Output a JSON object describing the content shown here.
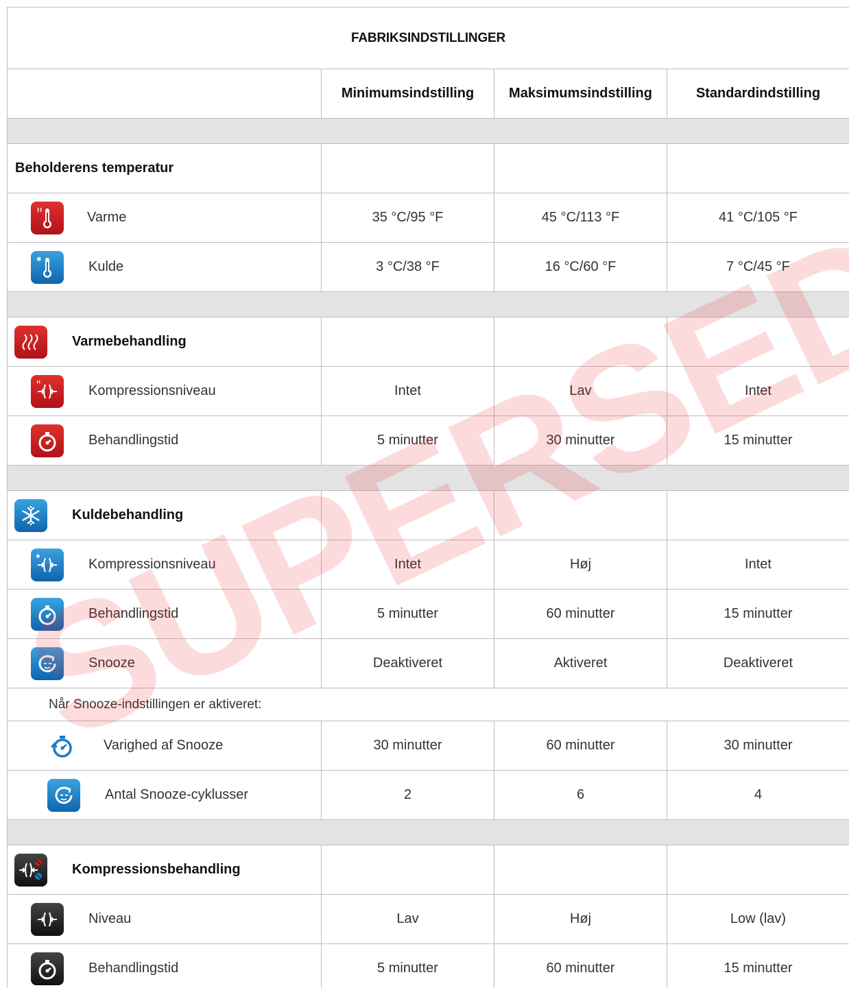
{
  "title": "FABRIKSINDSTILLINGER",
  "columns": [
    "",
    "Minimumsindstilling",
    "Maksimumsindstilling",
    "Standardindstilling"
  ],
  "sections": [
    {
      "label": "Beholderens temperatur",
      "icon": null,
      "rows": [
        {
          "icon": "heat-thermometer-icon",
          "label": "Varme",
          "min": "35 °C/95 °F",
          "max": "45 °C/113 °F",
          "std": "41 °C/105 °F"
        },
        {
          "icon": "cold-thermometer-icon",
          "label": "Kulde",
          "min": "3 °C/38 °F",
          "max": "16 °C/60 °F",
          "std": "7 °C/45 °F"
        }
      ]
    },
    {
      "label": "Varmebehandling",
      "icon": "heat-therapy-icon",
      "rows": [
        {
          "icon": "heat-compression-icon",
          "label": "Kompressionsniveau",
          "min": "Intet",
          "max": "Lav",
          "std": "Intet"
        },
        {
          "icon": "heat-timer-icon",
          "label": "Behandlingstid",
          "min": "5 minutter",
          "max": "30 minutter",
          "std": "15 minutter"
        }
      ]
    },
    {
      "label": "Kuldebehandling",
      "icon": "cold-therapy-icon",
      "rows": [
        {
          "icon": "cold-compression-icon",
          "label": "Kompressionsniveau",
          "min": "Intet",
          "max": "Høj",
          "std": "Intet"
        },
        {
          "icon": "cold-timer-icon",
          "label": "Behandlingstid",
          "min": "5 minutter",
          "max": "60 minutter",
          "std": "15 minutter"
        },
        {
          "icon": "snooze-icon",
          "label": "Snooze",
          "min": "Deaktiveret",
          "max": "Aktiveret",
          "std": "Deaktiveret"
        }
      ],
      "note": "Når Snooze-indstillingen er aktiveret:",
      "sub_rows": [
        {
          "icon": "snooze-duration-icon",
          "label": "Varighed af Snooze",
          "min": "30 minutter",
          "max": "60 minutter",
          "std": "30 minutter"
        },
        {
          "icon": "snooze-cycles-icon",
          "label": "Antal Snooze-cyklusser",
          "min": "2",
          "max": "6",
          "std": "4"
        }
      ]
    },
    {
      "label": "Kompressionsbehandling",
      "icon": "compression-therapy-icon",
      "rows": [
        {
          "icon": "compression-level-icon",
          "label": "Niveau",
          "min": "Lav",
          "max": "Høj",
          "std": "Low (lav)"
        },
        {
          "icon": "compression-timer-icon",
          "label": "Behandlingstid",
          "min": "5 minutter",
          "max": "60 minutter",
          "std": "15 minutter"
        }
      ]
    }
  ],
  "watermark": "SUPERSEDED",
  "colors": {
    "heat": "#c8191f",
    "cold": "#1f7ac4",
    "dark": "#222222",
    "watermark": "#e8283a",
    "gray_row": "#e3e3e3"
  }
}
